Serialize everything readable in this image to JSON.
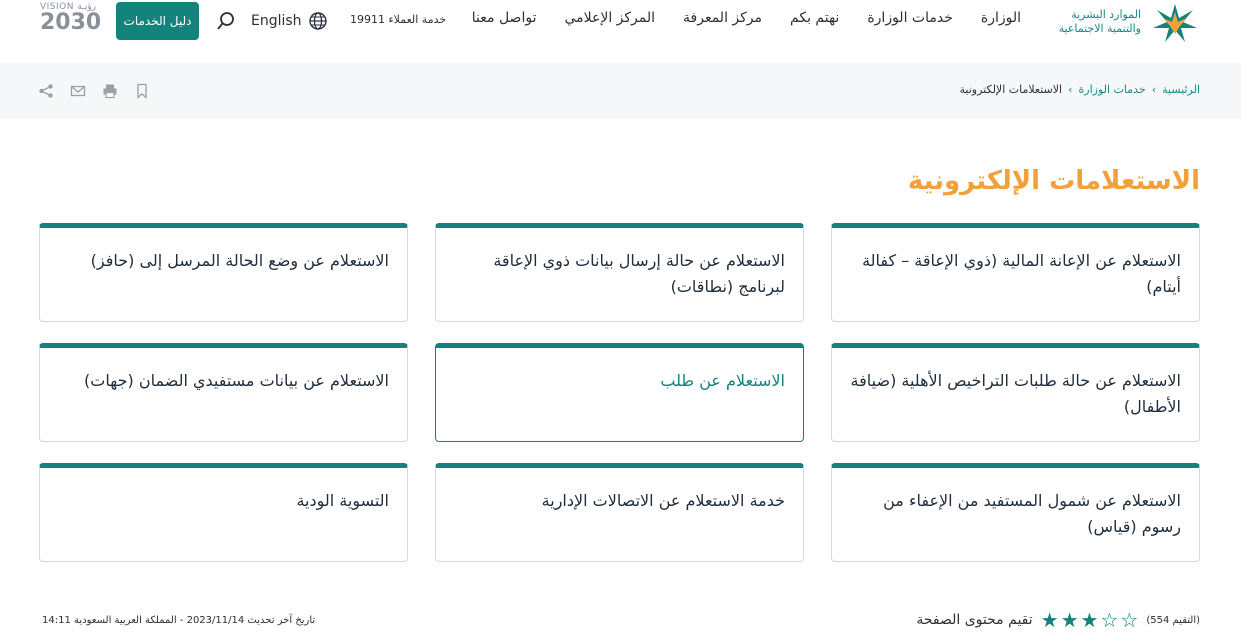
{
  "header": {
    "logo_line1": "الموارد البشرية",
    "logo_line2": "والتنمية الاجتماعية",
    "nav": [
      "الوزارة",
      "خدمات الوزارة",
      "نهتم بكم",
      "مركز المعرفة",
      "المركز الإعلامي",
      "تواصل معنا"
    ],
    "customer_service": "خدمة العملاء 19911",
    "language": "English",
    "services_button": "دليل الخدمات",
    "vision_line1": "VISION رؤيـة",
    "vision_line2": "2030"
  },
  "breadcrumb": {
    "home": "الرئيسية",
    "services": "خدمات الوزارة",
    "current": "الاستعلامات الإلكترونية"
  },
  "page_title": "الاستعلامات الإلكترونية",
  "cards": [
    "الاستعلام عن الإعانة المالية (ذوي الإعاقة – كفالة أيتام)",
    "الاستعلام عن حالة إرسال بيانات ذوي الإعاقة لبرنامج (نطاقات)",
    "الاستعلام عن وضع الحالة المرسل إلى (حافز)",
    "الاستعلام عن حالة طلبات التراخيص الأهلية (ضيافة الأطفال)",
    "الاستعلام عن طلب",
    "الاستعلام عن بيانات مستفيدي الضمان (جهات)",
    "الاستعلام عن شمول المستفيد من الإعفاء من رسوم (قياس)",
    "خدمة الاستعلام عن الاتصالات الإدارية",
    "التسوية الودية"
  ],
  "rating": {
    "label": "تقيم محتوى الصفحة",
    "count": "(التقيم 554)",
    "stars_filled": 3,
    "stars_total": 5
  },
  "footer": {
    "last_update": "تاريخ آخر تحديث 2023/11/14 - المملكة العربية السعودية 14:11"
  },
  "colors": {
    "accent": "#14837c",
    "title": "#f2a13a"
  }
}
